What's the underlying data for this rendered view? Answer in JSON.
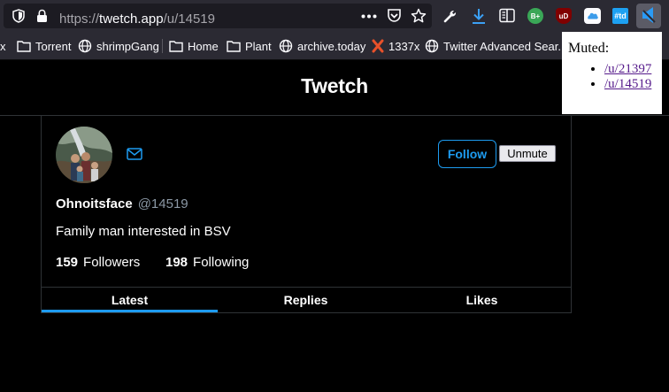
{
  "browser": {
    "url_scheme": "https://",
    "url_host": "twetch.app",
    "url_path": "/u/14519",
    "bookmarks": [
      {
        "label": "x",
        "icon": "none"
      },
      {
        "label": "Torrent",
        "icon": "folder-icon"
      },
      {
        "label": "shrimpGang",
        "icon": "globe-icon"
      },
      {
        "label": "Home",
        "icon": "folder-icon"
      },
      {
        "label": "Plant",
        "icon": "folder-icon"
      },
      {
        "label": "archive.today",
        "icon": "globe-icon"
      },
      {
        "label": "1337x",
        "icon": "x-logo-icon"
      },
      {
        "label": "Twitter Advanced Sear...",
        "icon": "globe-icon"
      }
    ],
    "extensions": [
      {
        "name": "wrench-icon"
      },
      {
        "name": "download-icon"
      },
      {
        "name": "reader-view-icon"
      },
      {
        "name": "b-plus-extension-icon",
        "label": "B+",
        "color": "#3aa757"
      },
      {
        "name": "ublock-origin-icon",
        "label": "uD",
        "color": "#800000"
      },
      {
        "name": "icloud-icon"
      },
      {
        "name": "tweetdeck-icon",
        "label": "#td",
        "color": "#1da1f2"
      },
      {
        "name": "mute-extension-icon"
      }
    ]
  },
  "site": {
    "title": "Twetch"
  },
  "profile": {
    "display_name": "Ohnoitsface",
    "handle": "@14519",
    "bio": "Family man interested in BSV",
    "followers_count": "159",
    "followers_label": "Followers",
    "following_count": "198",
    "following_label": "Following",
    "follow_label": "Follow",
    "unmute_label": "Unmute"
  },
  "tabs": [
    {
      "label": "Latest",
      "active": true
    },
    {
      "label": "Replies",
      "active": false
    },
    {
      "label": "Likes",
      "active": false
    }
  ],
  "muted_popup": {
    "title": "Muted:",
    "items": [
      "/u/21397",
      "/u/14519"
    ]
  },
  "colors": {
    "accent": "#1d9bf0",
    "background": "#000000",
    "chrome": "#2b2a33"
  }
}
